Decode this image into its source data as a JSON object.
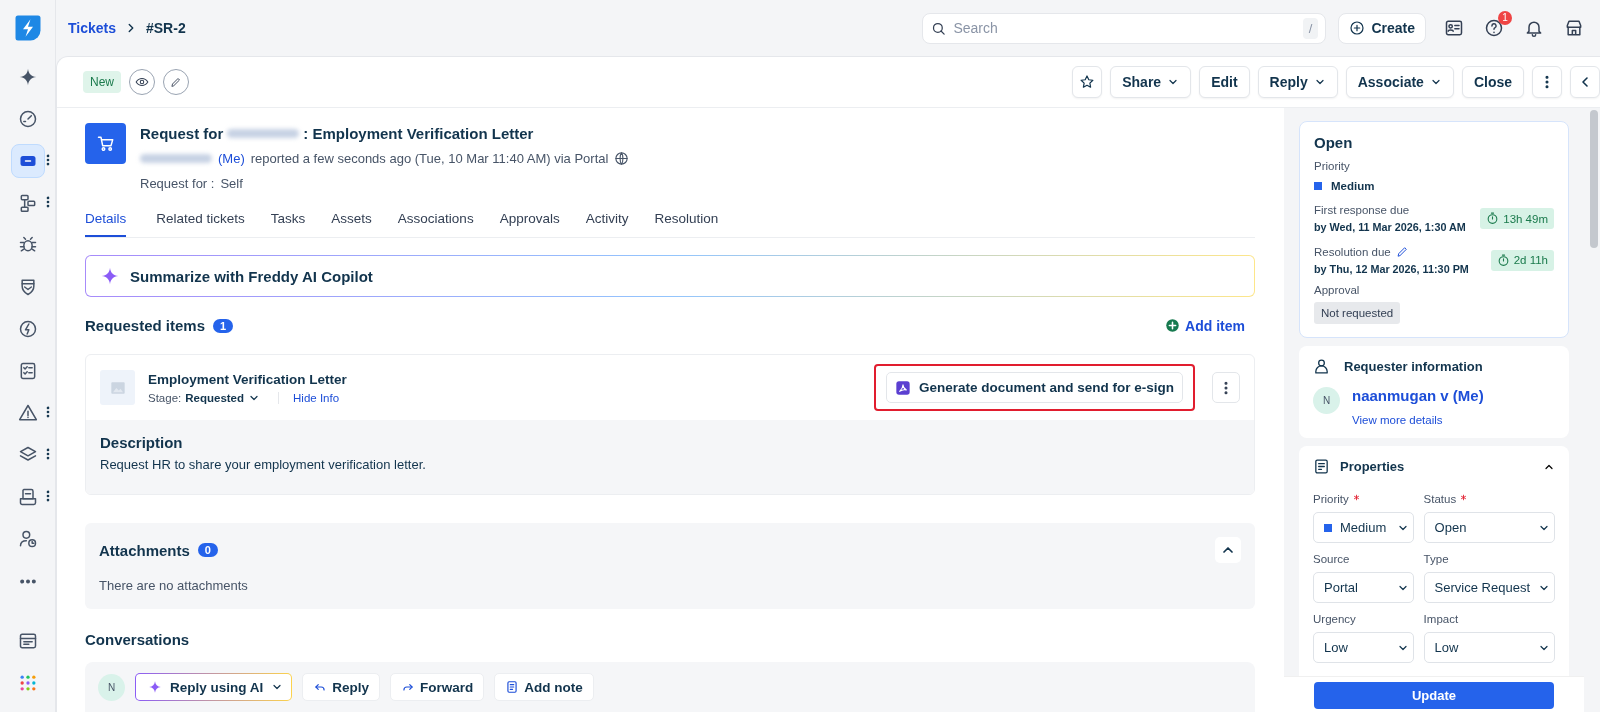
{
  "sidebar": {
    "items": [
      {
        "kind": "sparkle",
        "selected": false,
        "menu": false
      },
      {
        "kind": "gauge",
        "selected": false,
        "menu": false
      },
      {
        "kind": "ticket",
        "selected": true,
        "menu": true
      },
      {
        "kind": "flow",
        "selected": false,
        "menu": true
      },
      {
        "kind": "bug",
        "selected": false,
        "menu": false
      },
      {
        "kind": "shield",
        "selected": false,
        "menu": false
      },
      {
        "kind": "bolt",
        "selected": false,
        "menu": false
      },
      {
        "kind": "checklist",
        "selected": false,
        "menu": false
      },
      {
        "kind": "warning",
        "selected": false,
        "menu": true
      },
      {
        "kind": "layers",
        "selected": false,
        "menu": true
      },
      {
        "kind": "inbox",
        "selected": false,
        "menu": true
      },
      {
        "kind": "user-clock",
        "selected": false,
        "menu": false
      },
      {
        "kind": "more",
        "selected": false,
        "menu": false
      }
    ],
    "bottom": [
      {
        "kind": "window",
        "selected": false,
        "menu": false
      },
      {
        "kind": "apps",
        "selected": false,
        "menu": false
      }
    ]
  },
  "breadcrumb": [
    "Tickets",
    "#SR-2"
  ],
  "search": {
    "placeholder": "Search",
    "shortcut": "/"
  },
  "create_button": "Create",
  "help_badge": "1",
  "ticket": {
    "status_tag": "New",
    "title_prefix": "Request for",
    "title_suffix": ": Employment Verification Letter",
    "requester_me": "(Me)",
    "reported": "reported a few seconds ago (Tue, 10 Mar 11:40 AM) via Portal",
    "request_for_label": "Request for :",
    "request_for_value": "Self"
  },
  "actions": [
    {
      "label": "Share",
      "dropdown": true
    },
    {
      "label": "Edit",
      "dropdown": false
    },
    {
      "label": "Reply",
      "dropdown": true
    },
    {
      "label": "Associate",
      "dropdown": true
    },
    {
      "label": "Close",
      "dropdown": false
    }
  ],
  "tabs": [
    {
      "label": "Details",
      "selected": true
    },
    {
      "label": "Related tickets",
      "selected": false
    },
    {
      "label": "Tasks",
      "selected": false
    },
    {
      "label": "Assets",
      "selected": false
    },
    {
      "label": "Associations",
      "selected": false
    },
    {
      "label": "Approvals",
      "selected": false
    },
    {
      "label": "Activity",
      "selected": false
    },
    {
      "label": "Resolution",
      "selected": false
    }
  ],
  "copilot": "Summarize with Freddy AI Copilot",
  "requested_items": {
    "title": "Requested items",
    "count": "1",
    "add": "Add item",
    "items": [
      {
        "name": "Employment Verification Letter",
        "stage_label": "Stage:",
        "stage": "Requested",
        "hide_info": "Hide Info",
        "action": "Generate document and send for e-sign",
        "highlighted": true,
        "description_title": "Description",
        "description": "Request HR to share your employment verification letter."
      }
    ]
  },
  "attachments": {
    "title": "Attachments",
    "count": "0",
    "empty": "There are no attachments",
    "expanded": true
  },
  "conversations": {
    "title": "Conversations",
    "avatar": "N",
    "buttons": [
      {
        "kind": "ai",
        "label": "Reply using AI"
      },
      {
        "kind": "reply",
        "label": "Reply"
      },
      {
        "kind": "forward",
        "label": "Forward"
      },
      {
        "kind": "note",
        "label": "Add note"
      }
    ]
  },
  "status_card": {
    "status": "Open",
    "priority_label": "Priority",
    "priority": "Medium",
    "dues": [
      {
        "label": "First response due",
        "editable": false,
        "date": "by Wed, 11 Mar 2026, 1:30 AM",
        "timer": "13h 49m"
      },
      {
        "label": "Resolution due",
        "editable": true,
        "date": "by Thu, 12 Mar 2026, 11:30 PM",
        "timer": "2d 11h"
      }
    ],
    "approval_label": "Approval",
    "approval": "Not requested"
  },
  "requester": {
    "title": "Requester information",
    "avatar": "N",
    "name": "naanmugan v (Me)",
    "link": "View more details"
  },
  "properties": {
    "title": "Properties",
    "expanded": true,
    "fields": [
      {
        "label": "Priority",
        "required": true,
        "value": "Medium",
        "swatch": true
      },
      {
        "label": "Status",
        "required": true,
        "value": "Open",
        "swatch": false
      },
      {
        "label": "Source",
        "required": false,
        "value": "Portal",
        "swatch": false
      },
      {
        "label": "Type",
        "required": false,
        "value": "Service Request",
        "swatch": false
      },
      {
        "label": "Urgency",
        "required": false,
        "value": "Low",
        "swatch": false
      },
      {
        "label": "Impact",
        "required": false,
        "value": "Low",
        "swatch": false
      }
    ],
    "update": "Update"
  }
}
